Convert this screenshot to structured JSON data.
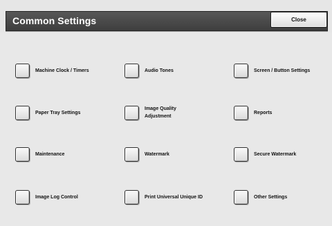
{
  "header": {
    "title": "Common Settings",
    "close_label": "Close"
  },
  "items": [
    {
      "label": "Machine Clock / Timers"
    },
    {
      "label": "Audio Tones"
    },
    {
      "label": "Screen / Button Settings"
    },
    {
      "label": "Paper Tray Settings"
    },
    {
      "label": "Image Quality\nAdjustment"
    },
    {
      "label": "Reports"
    },
    {
      "label": "Maintenance"
    },
    {
      "label": "Watermark"
    },
    {
      "label": "Secure Watermark"
    },
    {
      "label": "Image Log Control"
    },
    {
      "label": "Print Universal Unique ID"
    },
    {
      "label": "Other Settings"
    }
  ]
}
